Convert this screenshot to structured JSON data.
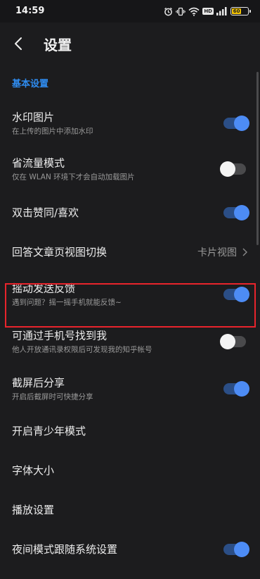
{
  "status_bar": {
    "time": "14:59",
    "icons": [
      "alarm-icon",
      "vibrate-icon",
      "wifi-icon",
      "hd-icon",
      "signal-icon",
      "battery-icon"
    ],
    "hd_label": "HD",
    "battery_level": "60",
    "battery_fraction": 0.6
  },
  "app_bar": {
    "title": "设置",
    "back_icon": "chevron-left-icon"
  },
  "colors": {
    "accent": "#2f8cf0",
    "toggle_on": "#4d8cf5",
    "highlight_border": "#e8242c",
    "background": "#1c1c1e"
  },
  "section": {
    "header": "基本设置"
  },
  "rows": [
    {
      "title": "水印图片",
      "subtitle": "在上传的图片中添加水印",
      "control": "toggle",
      "on": true
    },
    {
      "title": "省流量模式",
      "subtitle": "仅在 WLAN 环境下才会自动加载图片",
      "control": "toggle",
      "on": false
    },
    {
      "title": "双击赞同/喜欢",
      "control": "toggle",
      "on": true
    },
    {
      "title": "回答文章页视图切换",
      "control": "value",
      "value": "卡片视图"
    },
    {
      "title": "摇动发送反馈",
      "subtitle": "遇到问题？摇一摇手机就能反馈~",
      "control": "toggle",
      "on": true,
      "highlighted": true
    },
    {
      "title": "可通过手机号找到我",
      "subtitle": "他人开放通讯录权限后可发现我的知乎帐号",
      "control": "toggle",
      "on": false
    },
    {
      "title": "截屏后分享",
      "subtitle": "开启后截屏时可快捷分享",
      "control": "toggle",
      "on": true
    },
    {
      "title": "开启青少年模式",
      "control": "none"
    },
    {
      "title": "字体大小",
      "control": "none"
    },
    {
      "title": "播放设置",
      "control": "none"
    },
    {
      "title": "夜间模式跟随系统设置",
      "control": "toggle",
      "on": true
    }
  ]
}
